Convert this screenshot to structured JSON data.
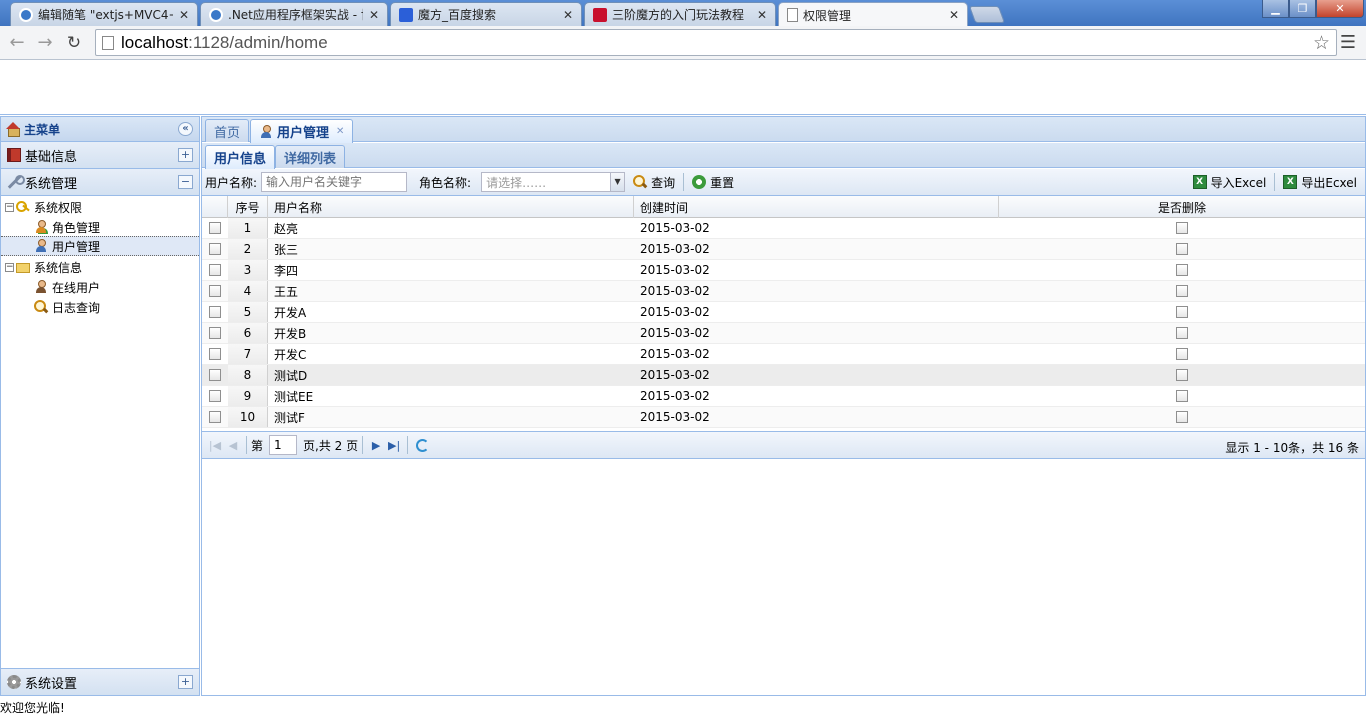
{
  "browser": {
    "tabs": [
      {
        "title": "编辑随笔 \"extjs+MVC4+",
        "favicon_color": "#3a78c8"
      },
      {
        "title": ".Net应用程序框架实战 - 博",
        "favicon_color": "#3a78c8"
      },
      {
        "title": "魔方_百度搜索",
        "favicon_color": "#2b5fd8"
      },
      {
        "title": "三阶魔方的入门玩法教程",
        "favicon_color": "#c8102e"
      },
      {
        "title": "权限管理",
        "favicon_color": "#ffffff"
      }
    ],
    "url_host": "localhost",
    "url_path": ":1128/admin/home"
  },
  "west": {
    "title": "主菜单",
    "sections": [
      {
        "label": "基础信息",
        "icon": "book-icon",
        "state": "+"
      },
      {
        "label": "系统管理",
        "icon": "wrench-icon",
        "state": "−"
      }
    ],
    "tree": [
      {
        "label": "系统权限",
        "level": 0,
        "icon": "key-icon",
        "expander": "−"
      },
      {
        "label": "角色管理",
        "level": 1,
        "icon": "role-icon"
      },
      {
        "label": "用户管理",
        "level": 1,
        "icon": "user-icon",
        "selected": true
      },
      {
        "label": "系统信息",
        "level": 0,
        "icon": "folder-icon",
        "expander": "−"
      },
      {
        "label": "在线用户",
        "level": 1,
        "icon": "online-user-icon"
      },
      {
        "label": "日志查询",
        "level": 1,
        "icon": "search-icon"
      }
    ],
    "bottom_section": {
      "label": "系统设置",
      "icon": "gear-icon",
      "state": "+"
    }
  },
  "main_tabs": [
    {
      "label": "首页"
    },
    {
      "label": "用户管理",
      "active": true
    }
  ],
  "sub_tabs": [
    {
      "label": "用户信息",
      "active": true
    },
    {
      "label": "详细列表"
    }
  ],
  "toolbar": {
    "username_label": "用户名称:",
    "username_placeholder": "输入用户名关键字",
    "role_label": "角色名称:",
    "role_placeholder": "请选择……",
    "search_button": "查询",
    "reset_button": "重置",
    "import_button": "导入Excel",
    "export_button": "导出Ecxel"
  },
  "grid": {
    "columns": [
      "序号",
      "用户名称",
      "创建时间",
      "是否删除"
    ],
    "rows": [
      {
        "no": "1",
        "name": "赵亮",
        "created": "2015-03-02"
      },
      {
        "no": "2",
        "name": "张三",
        "created": "2015-03-02"
      },
      {
        "no": "3",
        "name": "李四",
        "created": "2015-03-02"
      },
      {
        "no": "4",
        "name": "王五",
        "created": "2015-03-02"
      },
      {
        "no": "5",
        "name": "开发A",
        "created": "2015-03-02"
      },
      {
        "no": "6",
        "name": "开发B",
        "created": "2015-03-02"
      },
      {
        "no": "7",
        "name": "开发C",
        "created": "2015-03-02"
      },
      {
        "no": "8",
        "name": "测试D",
        "created": "2015-03-02"
      },
      {
        "no": "9",
        "name": "测试EE",
        "created": "2015-03-02"
      },
      {
        "no": "10",
        "name": "测试F",
        "created": "2015-03-02"
      }
    ]
  },
  "pager": {
    "page_prefix": "第",
    "current_page": "1",
    "page_suffix": "页,共 2 页",
    "display_info": "显示 1 - 10条，共 16 条"
  },
  "status_text": "欢迎您光临!"
}
